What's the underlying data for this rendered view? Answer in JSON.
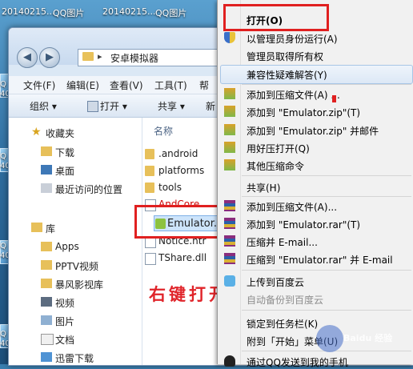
{
  "desktop": {
    "top_labels": [
      "20140215...",
      "QQ图片",
      "20140215...",
      "QQ图片"
    ],
    "edge_labels": [
      "Q",
      "40",
      "Q",
      "40",
      "Q",
      "40",
      "Q",
      "40"
    ]
  },
  "window": {
    "breadcrumb": "安卓模拟器",
    "menu": [
      "文件(F)",
      "编辑(E)",
      "查看(V)",
      "工具(T)",
      "帮"
    ],
    "toolbar": {
      "organize": "组织 ▾",
      "open": "打开 ▾",
      "share": "共享 ▾",
      "new_folder": "新"
    },
    "nav": {
      "favorites": "收藏夹",
      "favorites_items": [
        "下载",
        "桌面",
        "最近访问的位置"
      ],
      "libraries": "库",
      "library_items": [
        "Apps",
        "PPTV视频",
        "暴风影视库",
        "视频",
        "图片",
        "文档",
        "迅雷下载"
      ]
    },
    "column_header": "名称",
    "files": [
      {
        "name": ".android",
        "kind": "folder"
      },
      {
        "name": "platforms",
        "kind": "folder"
      },
      {
        "name": "tools",
        "kind": "folder"
      },
      {
        "name": "AndCore",
        "kind": "doc"
      },
      {
        "name": "Emulator.e",
        "kind": "exe"
      },
      {
        "name": "Notice.htr",
        "kind": "doc"
      },
      {
        "name": "TShare.dll",
        "kind": "doc"
      }
    ]
  },
  "annotation": "右键打开",
  "context_menu": {
    "items": [
      {
        "label": "打开(O)",
        "bold": true,
        "icon": "none"
      },
      {
        "label": "以管理员身份运行(A)",
        "icon": "shield-icon"
      },
      {
        "label": "管理员取得所有权",
        "icon": "none"
      },
      {
        "label": "兼容性疑难解答(Y)",
        "icon": "none"
      },
      {
        "label": "添加到压缩文件(A) ...",
        "icon": "archive-icon"
      },
      {
        "label": "添加到 \"Emulator.zip\"(T)",
        "icon": "archive-icon"
      },
      {
        "label": "添加到 \"Emulator.zip\" 并邮件",
        "icon": "archive-icon"
      },
      {
        "label": "用好压打开(Q)",
        "icon": "archive-icon"
      },
      {
        "label": "其他压缩命令",
        "icon": "archive-icon"
      },
      {
        "label": "共享(H)",
        "icon": "none"
      },
      {
        "label": "添加到压缩文件(A)...",
        "icon": "winrar-icon"
      },
      {
        "label": "添加到 \"Emulator.rar\"(T)",
        "icon": "winrar-icon"
      },
      {
        "label": "压缩并 E-mail...",
        "icon": "winrar-icon"
      },
      {
        "label": "压缩到 \"Emulator.rar\" 并 E-mail",
        "icon": "winrar-icon"
      },
      {
        "label": "上传到百度云",
        "icon": "cloud-icon"
      },
      {
        "label": "自动备份到百度云",
        "disabled": true,
        "icon": "none"
      },
      {
        "label": "锁定到任务栏(K)",
        "icon": "none"
      },
      {
        "label": "附到「开始」菜单(U)",
        "icon": "none"
      },
      {
        "label": "通过QQ发送到我的手机",
        "icon": "qq-icon"
      }
    ]
  },
  "watermark": "Baidu 经验",
  "colors": {
    "annotation_red": "#e02020",
    "highlight": "#dce8f6"
  }
}
